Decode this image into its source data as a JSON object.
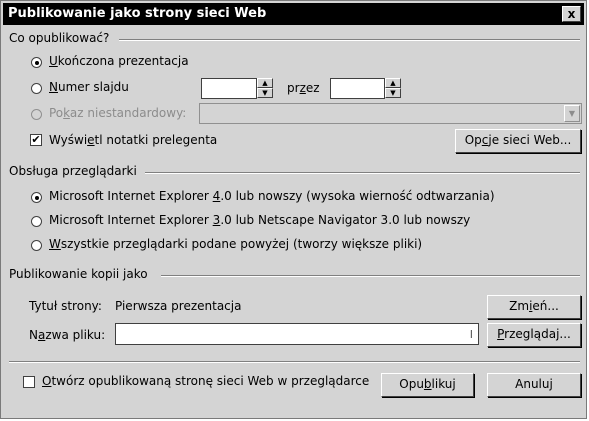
{
  "window": {
    "title": "Publikowanie jako strony sieci Web",
    "close_glyph": "x"
  },
  "publish_what": {
    "group_label": "Co opublikować?",
    "option_complete": {
      "pre": "",
      "key": "U",
      "post": "kończona prezentacja",
      "checked": true
    },
    "option_slide_number": {
      "pre": "",
      "key": "N",
      "post": "umer slajdu",
      "checked": false
    },
    "through_label": {
      "pre": "pr",
      "key": "z",
      "post": "ez"
    },
    "option_custom": {
      "pre": "Po",
      "key": "k",
      "post": "az niestandardowy:",
      "checked": false,
      "disabled": true
    },
    "show_notes": {
      "pre": "Wyświ",
      "key": "e",
      "post": "tl notatki prelegenta",
      "checked": true
    },
    "web_options_button": {
      "pre": "Op",
      "key": "c",
      "post": "je sieci Web..."
    }
  },
  "browser_support": {
    "group_label": "Obsługa przeglądarki",
    "option_ie4": {
      "pre": "Microsoft Internet Explorer ",
      "key": "4",
      "post": ".0 lub nowszy (wysoka wierność odtwarzania)",
      "checked": true
    },
    "option_ie3": {
      "pre": "Microsoft Internet Explorer ",
      "key": "3",
      "post": ".0 lub Netscape Navigator 3.0 lub nowszy",
      "checked": false
    },
    "option_all": {
      "pre": "",
      "key": "W",
      "post": "szystkie przeglądarki podane powyżej (tworzy większe pliki)",
      "checked": false
    }
  },
  "publish_copy": {
    "group_label": "Publikowanie kopii jako",
    "page_title_label": "Tytuł strony:",
    "page_title_value": "Pierwsza prezentacja",
    "change_button": {
      "pre": "Zm",
      "key": "i",
      "post": "eń..."
    },
    "file_name_label": {
      "pre": "N",
      "key": "a",
      "post": "zwa pliku:"
    },
    "file_name_value": "",
    "browse_button": {
      "pre": "",
      "key": "P",
      "post": "rzeglądaj..."
    }
  },
  "footer": {
    "open_in_browser": {
      "pre": "",
      "key": "O",
      "post": "twórz opublikowaną stronę sieci Web w przeglądarce",
      "checked": false
    },
    "publish_button": {
      "pre": "Opu",
      "key": "b",
      "post": "likuj"
    },
    "cancel_button": "Anuluj"
  },
  "icons": {
    "spin_up": "▲",
    "spin_down": "▼",
    "dropdown": "▼",
    "check": "✔"
  }
}
